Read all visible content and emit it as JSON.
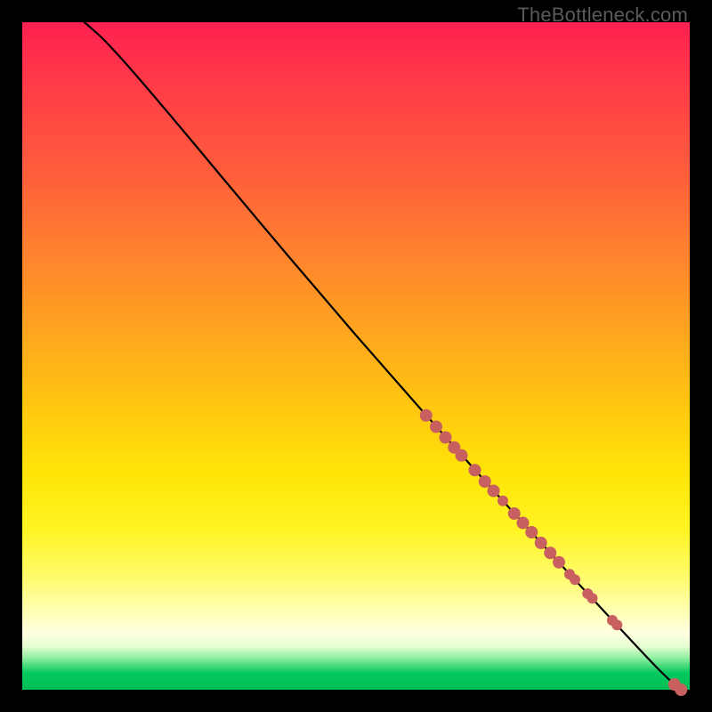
{
  "watermark": "TheBottleneck.com",
  "colors": {
    "line": "#000000",
    "dot": "#c96060",
    "page_bg": "#000000"
  },
  "chart_data": {
    "type": "line",
    "title": "",
    "xlabel": "",
    "ylabel": "",
    "xlim": [
      0,
      100
    ],
    "ylim": [
      0,
      100
    ],
    "grid": false,
    "legend": false,
    "line_points": [
      {
        "x": 9.3,
        "y": 100.0
      },
      {
        "x": 10.0,
        "y": 99.4
      },
      {
        "x": 12.0,
        "y": 97.6
      },
      {
        "x": 15.0,
        "y": 94.4
      },
      {
        "x": 19.0,
        "y": 89.8
      },
      {
        "x": 25.0,
        "y": 82.7
      },
      {
        "x": 30.0,
        "y": 76.7
      },
      {
        "x": 40.0,
        "y": 64.8
      },
      {
        "x": 50.0,
        "y": 53.1
      },
      {
        "x": 60.0,
        "y": 41.7
      },
      {
        "x": 70.0,
        "y": 30.5
      },
      {
        "x": 80.0,
        "y": 19.5
      },
      {
        "x": 90.0,
        "y": 8.7
      },
      {
        "x": 95.0,
        "y": 3.4
      },
      {
        "x": 98.0,
        "y": 0.5
      }
    ],
    "scatter_points": [
      {
        "x": 60.5,
        "y": 41.1,
        "r": 7
      },
      {
        "x": 62.0,
        "y": 39.4,
        "r": 7
      },
      {
        "x": 63.4,
        "y": 37.8,
        "r": 7
      },
      {
        "x": 64.7,
        "y": 36.3,
        "r": 7
      },
      {
        "x": 65.8,
        "y": 35.1,
        "r": 7
      },
      {
        "x": 67.8,
        "y": 32.9,
        "r": 7
      },
      {
        "x": 69.3,
        "y": 31.2,
        "r": 7
      },
      {
        "x": 70.6,
        "y": 29.8,
        "r": 7
      },
      {
        "x": 72.0,
        "y": 28.3,
        "r": 6
      },
      {
        "x": 73.7,
        "y": 26.4,
        "r": 7
      },
      {
        "x": 75.0,
        "y": 25.0,
        "r": 7
      },
      {
        "x": 76.3,
        "y": 23.6,
        "r": 7
      },
      {
        "x": 77.7,
        "y": 22.0,
        "r": 7
      },
      {
        "x": 79.1,
        "y": 20.5,
        "r": 7
      },
      {
        "x": 80.4,
        "y": 19.1,
        "r": 7
      },
      {
        "x": 82.0,
        "y": 17.3,
        "r": 6
      },
      {
        "x": 82.8,
        "y": 16.5,
        "r": 6
      },
      {
        "x": 84.7,
        "y": 14.4,
        "r": 6
      },
      {
        "x": 85.4,
        "y": 13.7,
        "r": 6
      },
      {
        "x": 88.4,
        "y": 10.4,
        "r": 6
      },
      {
        "x": 89.1,
        "y": 9.7,
        "r": 6
      },
      {
        "x": 97.7,
        "y": 0.8,
        "r": 7
      },
      {
        "x": 98.7,
        "y": 0.0,
        "r": 7
      }
    ]
  }
}
